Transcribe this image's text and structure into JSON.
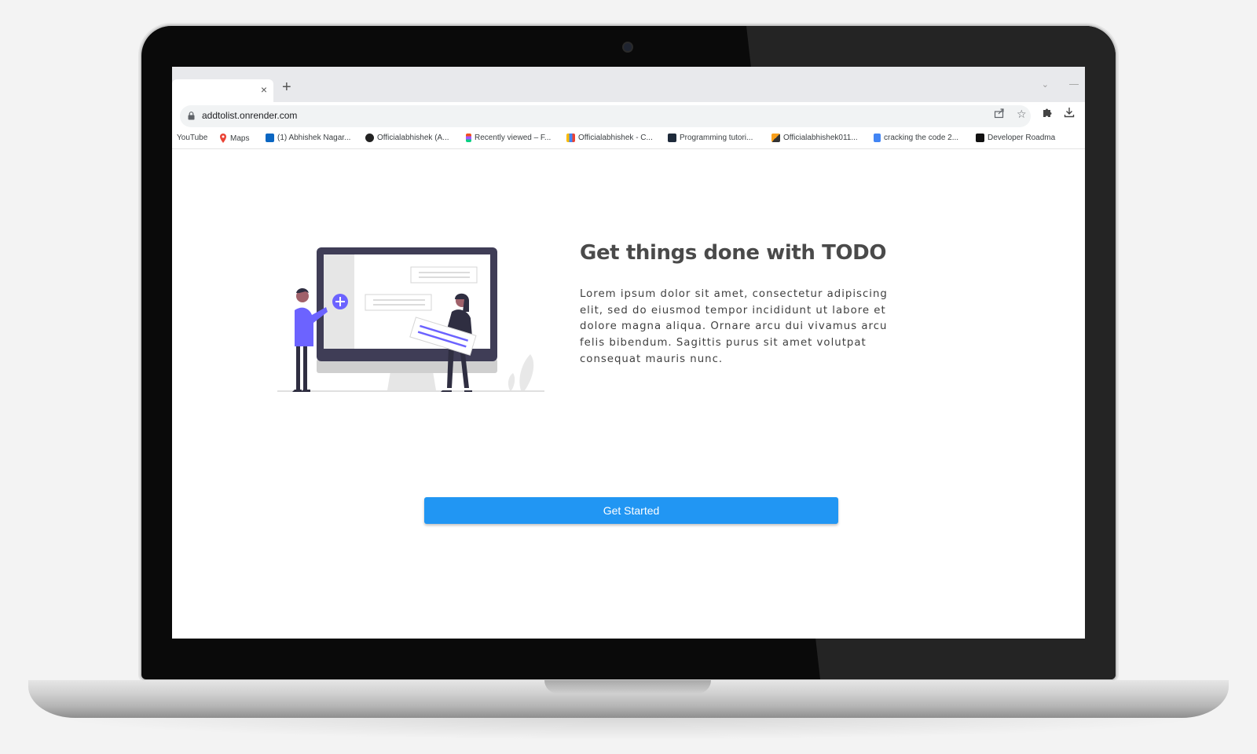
{
  "browser": {
    "tab_close": "×",
    "new_tab": "+",
    "url": "addtolist.onrender.com",
    "bookmarks": [
      {
        "label": "YouTube",
        "icon": "youtube-icon"
      },
      {
        "label": "Maps",
        "icon": "maps-pin-icon"
      },
      {
        "label": "(1) Abhishek Nagar...",
        "icon": "linkedin-icon"
      },
      {
        "label": "Officialabhishek (A...",
        "icon": "github-icon"
      },
      {
        "label": "Recently viewed – F...",
        "icon": "figma-icon"
      },
      {
        "label": "Officialabhishek - C...",
        "icon": "chart-icon"
      },
      {
        "label": "Programming tutori...",
        "icon": "hashnode-icon"
      },
      {
        "label": "Officialabhishek011...",
        "icon": "leetcode-icon"
      },
      {
        "label": "cracking the code 2...",
        "icon": "docs-icon"
      },
      {
        "label": "Developer Roadma",
        "icon": "roadmap-icon"
      }
    ]
  },
  "hero": {
    "title": "Get things done with TODO",
    "description": "Lorem ipsum dolor sit amet, consectetur adipiscing elit, sed do eiusmod tempor incididunt ut labore et dolore magna aliqua. Ornare arcu dui vivamus arcu felis bibendum. Sagittis purus sit amet volutpat consequat mauris nunc.",
    "cta_label": "Get Started"
  },
  "colors": {
    "accent": "#2196f3",
    "illustration_purple": "#6c63ff",
    "monitor_dark": "#3f3d56"
  }
}
